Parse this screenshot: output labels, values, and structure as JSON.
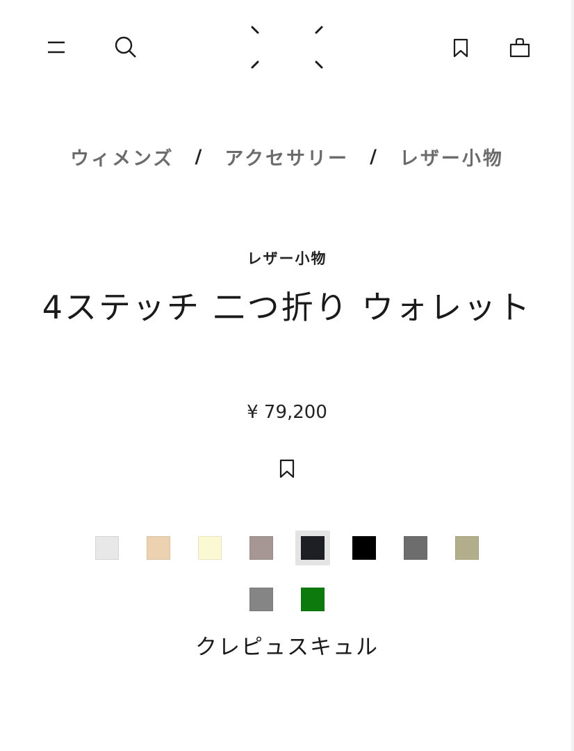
{
  "header": {
    "icons": [
      "menu-icon",
      "search-icon",
      "logo",
      "bookmark-icon",
      "shopping-bag-icon"
    ]
  },
  "breadcrumb": {
    "items": [
      "ウィメンズ",
      "アクセサリー",
      "レザー小物"
    ],
    "separator": "/"
  },
  "product": {
    "category": "レザー小物",
    "title": "4ステッチ 二つ折り ウォレット",
    "price": "¥ 79,200"
  },
  "colors": {
    "swatches": [
      "#e8e8e8",
      "#ecd2b0",
      "#fbf8d4",
      "#a69694",
      "#1d1f24",
      "#000000",
      "#6d6d6d",
      "#b2ae8c",
      "#858585",
      "#0d7a0d"
    ],
    "selected_index": 4,
    "selected_name": "クレピュスキュル"
  }
}
